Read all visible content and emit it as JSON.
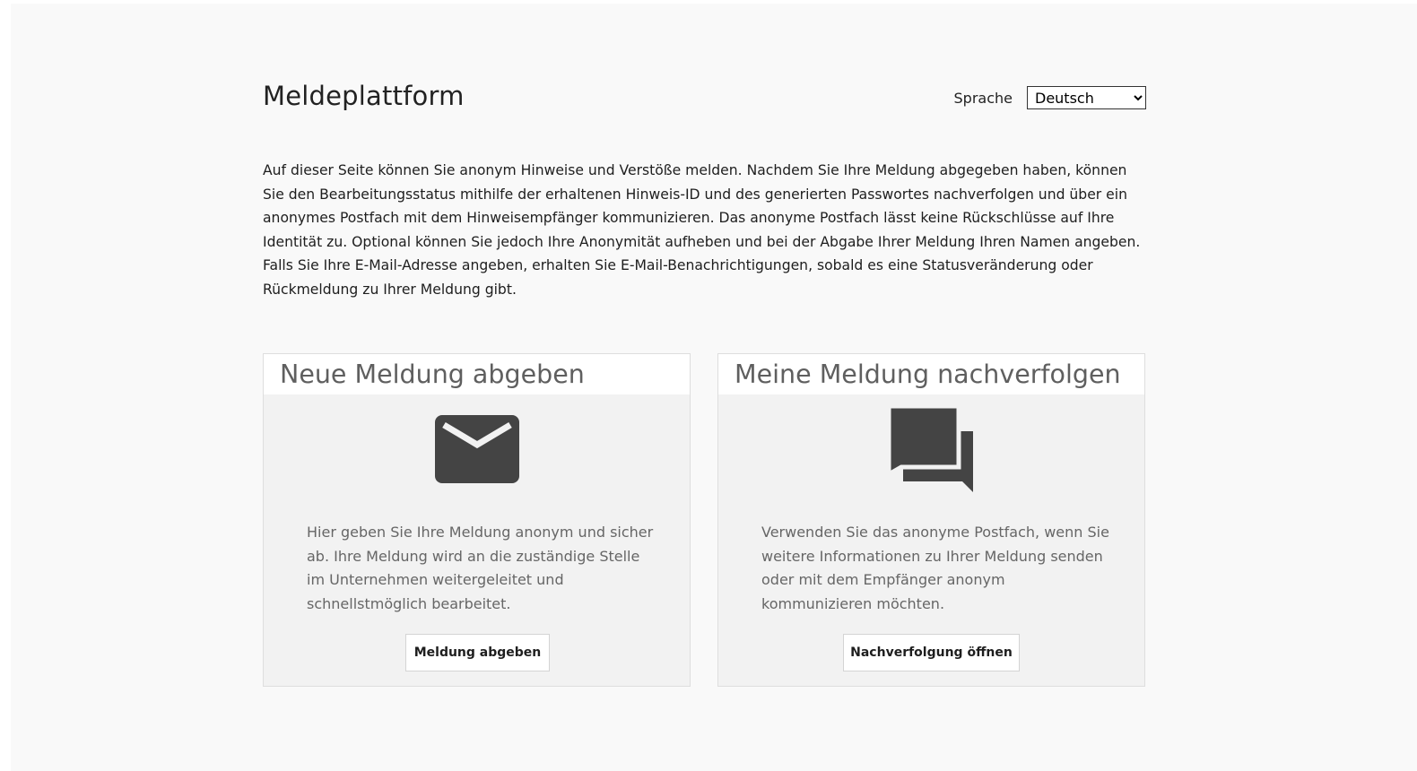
{
  "header": {
    "title": "Meldeplattform",
    "language_label": "Sprache",
    "language_selected": "Deutsch"
  },
  "intro": "Auf dieser Seite können Sie anonym Hinweise und Verstöße melden. Nachdem Sie Ihre Meldung abgegeben haben, können Sie den Bearbeitungsstatus mithilfe der erhaltenen Hinweis-ID und des generierten Passwortes nachverfolgen und über ein anonymes Postfach mit dem Hinweisempfänger kommunizieren. Das anonyme Postfach lässt keine Rückschlüsse auf Ihre Identität zu. Optional können Sie jedoch Ihre Anonymität aufheben und bei der Abgabe Ihrer Meldung Ihren Namen angeben. Falls Sie Ihre E-Mail-Adresse angeben, erhalten Sie E-Mail-Benachrichtigungen, sobald es eine Statusveränderung oder Rückmeldung zu Ihrer Meldung gibt.",
  "cards": [
    {
      "title": "Neue Meldung abgeben",
      "icon": "envelope-icon",
      "text": "Hier geben Sie Ihre Meldung anonym und sicher ab. Ihre Meldung wird an die zuständige Stelle im Unternehmen weitergeleitet und schnellstmöglich bearbeitet.",
      "button": "Meldung abgeben"
    },
    {
      "title": "Meine Meldung nachverfolgen",
      "icon": "chat-bubbles-icon",
      "text": "Verwenden Sie das anonyme Postfach, wenn Sie weitere Informationen zu Ihrer Meldung senden oder mit dem Empfänger anonym kommunizieren möchten.",
      "button": "Nachverfolgung öffnen"
    }
  ],
  "colors": {
    "page_background": "#f9f9f9",
    "card_background": "#f2f2f2",
    "icon": "#444444",
    "card_title": "#5f5f5f"
  }
}
